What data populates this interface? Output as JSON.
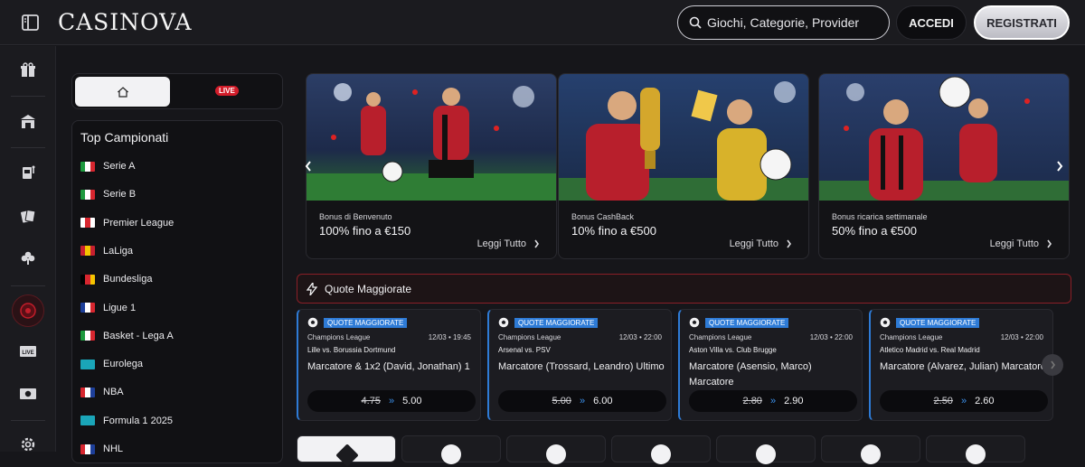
{
  "header": {
    "brand": "CASINOVA",
    "search_placeholder": "Giochi, Categorie, Provider",
    "login_label": "ACCEDI",
    "register_label": "REGISTRATI"
  },
  "sidebar": {
    "icons": [
      "gift-icon",
      "casino-building-icon",
      "slot-machine-icon",
      "cards-icon",
      "clover-icon",
      "roulette-icon",
      "live-tv-icon",
      "live-sport-icon",
      "settings-icon"
    ]
  },
  "sport_tabs": {
    "live_badge": "LIVE"
  },
  "leagues": {
    "heading": "Top Campionati",
    "items": [
      {
        "name": "Serie A",
        "flag": [
          "#1d9a3e",
          "#ffffff",
          "#d7262f"
        ]
      },
      {
        "name": "Serie B",
        "flag": [
          "#1d9a3e",
          "#ffffff",
          "#d7262f"
        ]
      },
      {
        "name": "Premier League",
        "flag": [
          "#ffffff",
          "#d7262f",
          "#ffffff"
        ]
      },
      {
        "name": "LaLiga",
        "flag": [
          "#c8202f",
          "#f5c400",
          "#c8202f"
        ]
      },
      {
        "name": "Bundesliga",
        "flag": [
          "#000000",
          "#d7262f",
          "#f5c400"
        ]
      },
      {
        "name": "Ligue 1",
        "flag": [
          "#1d3f9a",
          "#ffffff",
          "#d7262f"
        ]
      },
      {
        "name": "Basket - Lega A",
        "flag": [
          "#1d9a3e",
          "#ffffff",
          "#d7262f"
        ]
      },
      {
        "name": "Eurolega",
        "flag": [
          "#1aa5b8",
          "#1aa5b8",
          "#1aa5b8"
        ]
      },
      {
        "name": "NBA",
        "flag": [
          "#d7262f",
          "#ffffff",
          "#1d3f9a"
        ]
      },
      {
        "name": "Formula 1 2025",
        "flag": [
          "#1aa5b8",
          "#1aa5b8",
          "#1aa5b8"
        ]
      },
      {
        "name": "NHL",
        "flag": [
          "#d7262f",
          "#ffffff",
          "#1d3f9a"
        ]
      }
    ]
  },
  "promos": [
    {
      "kicker": "Bonus di Benvenuto",
      "title": "100% fino a €150",
      "more": "Leggi Tutto"
    },
    {
      "kicker": "Bonus CashBack",
      "title": "10% fino a €500",
      "more": "Leggi Tutto"
    },
    {
      "kicker": "Bonus ricarica settimanale",
      "title": "50% fino a €500",
      "more": "Leggi Tutto"
    }
  ],
  "boosted": {
    "title": "Quote Maggiorate",
    "cards": [
      {
        "badge": "QUOTE MAGGIORATE",
        "competition": "Champions League",
        "date": "12/03 • 19:45",
        "match": "Lille vs. Borussia Dortmund",
        "market": "Marcatore & 1x2 (David, Jonathan) 1",
        "old_odd": "4.75",
        "new_odd": "5.00"
      },
      {
        "badge": "QUOTE MAGGIORATE",
        "competition": "Champions League",
        "date": "12/03 • 22:00",
        "match": "Arsenal vs. PSV",
        "market": "Marcatore (Trossard, Leandro) Ultimo",
        "old_odd": "5.00",
        "new_odd": "6.00"
      },
      {
        "badge": "QUOTE MAGGIORATE",
        "competition": "Champions League",
        "date": "12/03 • 22:00",
        "match": "Aston Villa vs. Club Brugge",
        "market": "Marcatore (Asensio, Marco) Marcatore",
        "old_odd": "2.80",
        "new_odd": "2.90"
      },
      {
        "badge": "QUOTE MAGGIORATE",
        "competition": "Champions League",
        "date": "12/03 • 22:00",
        "match": "Atletico Madrid vs. Real Madrid",
        "market": "Marcatore (Alvarez, Julian) Marcatore",
        "old_odd": "2.50",
        "new_odd": "2.60"
      }
    ]
  },
  "colors": {
    "accent_red": "#d21d2a",
    "accent_blue": "#2e7bd6",
    "background": "#16161a"
  }
}
